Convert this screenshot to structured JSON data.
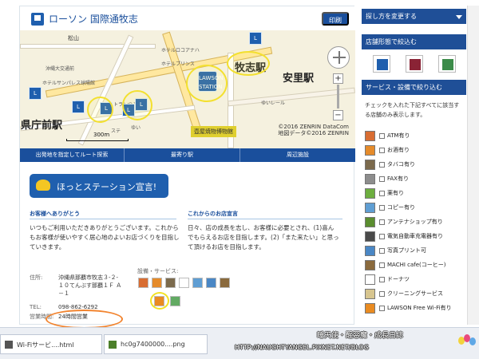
{
  "header": {
    "title": "ローソン 国際通牧志",
    "print_button": "印刷"
  },
  "map": {
    "labels": [
      "松山",
      "沖縄大交通前",
      "ホテルサンパレス球陽館",
      "ホテルロコアナハ",
      "ホテルプリンス",
      "レストランつるや",
      "牧志駅",
      "安里駅",
      "県庁前駅",
      "ゆいレール",
      "新都心通り",
      "国際通り",
      "松尾",
      "牧志十字路",
      "美栄橋駅",
      "泊",
      "ゆい",
      "ステ"
    ],
    "big_labels": [
      "牧志駅",
      "安里駅",
      "県庁前駅"
    ],
    "museum": "壺屋焼物博物館",
    "copyright_line1": "©2016 ZENRIN DataCom",
    "copyright_line2": "地図データ©2016 ZENRIN",
    "scale": "300m",
    "pin_label": "L",
    "lawson_station": "LAWSON STATION"
  },
  "tabs": [
    "出発地を指定してルート探索",
    "最寄り駅",
    "周辺施設"
  ],
  "declaration": "ほっとステーション宣言!",
  "message": {
    "left_heading": "お客様へありがとう",
    "left_text": "いつもご利用いただきありがとうございます。これからもお客様が使いやすく居心地のよいお店づくりを目指していきます。",
    "right_heading": "これからのお店宣言",
    "right_text": "日々、店の成長を志し、お客様に必要とされ、(1)喜んでもらえるお店を目指します。(2)「また来たい」と思って頂けるお店を目指します。"
  },
  "store": {
    "address_label": "住所:",
    "address_1": "沖縄県那覇市牧志３-２-",
    "address_2": "１０てんぶす那覇１Ｆ Ａ",
    "address_3": "－１",
    "tel_label": "TEL:",
    "tel": "098-862-6292",
    "hours_label": "営業時間:",
    "hours": "24時間営業",
    "services_label": "設備・サービス:"
  },
  "sidebar": {
    "change_method": "探し方を変更する",
    "store_filter": "店舗形態で絞込む",
    "service_filter": "サービス・設備で絞り込む",
    "description": "チェックを入れた下記すべてに該当する店舗のみ表示します。",
    "options": [
      "ATM有り",
      "お酒有り",
      "タバコ有り",
      "FAX有り",
      "薬有り",
      "コピー有り",
      "アンテナショップ有り",
      "電気自動車充電器有り",
      "写真プリント可",
      "MACHI cafe(コーヒー)",
      "ドーナツ",
      "クリーニングサービス",
      "LAWSON Free Wi-Fi有り"
    ]
  },
  "taskbar": {
    "tab1": "Wi-Fiサービ....html",
    "tab2": "hc0g7400000....png"
  },
  "watermark": {
    "blog": "睡天使・醒惡魔・成長日誌",
    "url": "HTTP://NAUGHTYANGEL.PIXNET.NET/BLOG"
  },
  "colors": {
    "accent": "#1a4f9c",
    "lawson_blue": "#1f5fae",
    "highlight_yellow": "#f3e02f",
    "highlight_orange": "#f2842f"
  }
}
